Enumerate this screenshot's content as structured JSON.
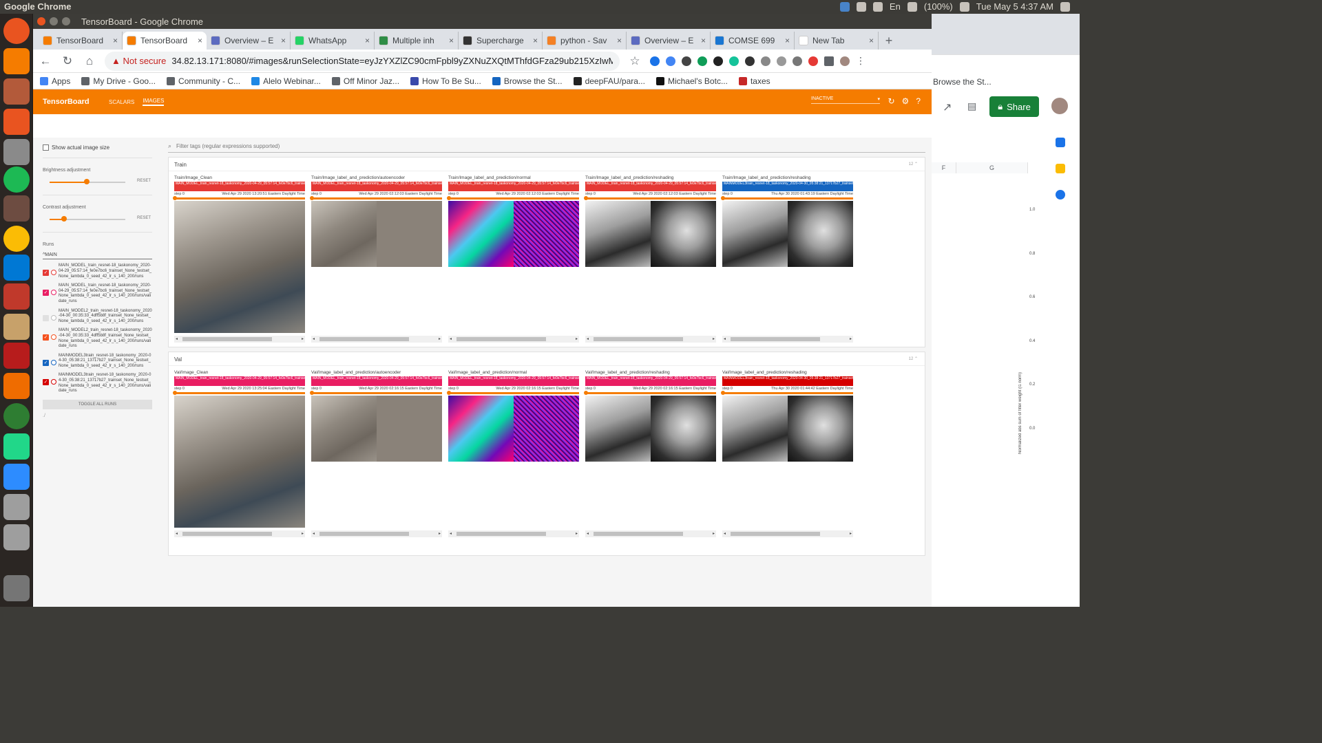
{
  "os": {
    "app_name": "Google Chrome",
    "tray": {
      "keyboard": "En",
      "battery": "(100%)",
      "clock": "Tue May 5  4:37 AM"
    }
  },
  "window": {
    "title": "TensorBoard - Google Chrome"
  },
  "tabs": [
    {
      "label": "TensorBoard",
      "color": "#f57c00"
    },
    {
      "label": "TensorBoard",
      "color": "#f57c00",
      "active": true
    },
    {
      "label": "Overview – E",
      "color": "#5c6bc0"
    },
    {
      "label": "WhatsApp",
      "color": "#25d366"
    },
    {
      "label": "Multiple inh",
      "color": "#2f8d46"
    },
    {
      "label": "Supercharge",
      "color": "#333333"
    },
    {
      "label": "python - Sav",
      "color": "#f48024"
    },
    {
      "label": "Overview – E",
      "color": "#5c6bc0"
    },
    {
      "label": "COMSE 699",
      "color": "#1976d2"
    },
    {
      "label": "New Tab",
      "color": "#ffffff"
    }
  ],
  "omnibox": {
    "security": "Not secure",
    "url": "34.82.13.171:8080/#images&runSelectionState=eyJzYXZlZC90cmFpbl9yZXNuZXQtMThfdGFza29ub215XzIwMjAtMDQtMj..."
  },
  "bookmarks": [
    "Apps",
    "My Drive - Goo...",
    "Community - C...",
    "Alelo Webinar...",
    "Off Minor Jaz...",
    "How To Be Su...",
    "Browse the St...",
    "deepFAU/para...",
    "Michael's Botc...",
    "taxes"
  ],
  "tensorboard": {
    "logo": "TensorBoard",
    "nav": [
      "SCALARS",
      "IMAGES"
    ],
    "inactive": "INACTIVE",
    "sidebar": {
      "show_actual": "Show actual image size",
      "brightness": "Brightness adjustment",
      "contrast": "Contrast adjustment",
      "reset": "RESET",
      "runs_label": "Runs",
      "runs_filter": "^MAIN",
      "runs": [
        {
          "name": "MAIN_MODEL_train_resnet-18_taskonomy_2020-04-29_05:57:14_fe0e7bc6_trainset_None_testset_None_lambda_0_seed_42_lr_s_140_200/runs",
          "checked": true,
          "color": "#e53935"
        },
        {
          "name": "MAIN_MODEL_train_resnet-18_taskonomy_2020-04-29_05:57:14_fe0e7bc6_trainset_None_testset_None_lambda_0_seed_42_lr_s_140_200/runs/validate_runs",
          "checked": true,
          "color": "#e91e63"
        },
        {
          "name": "MAIN_MODEL2_train_resnet-18_taskonomy_2020-04-30_00:35:33_4dff5b8f_trainset_None_testset_None_lambda_0_seed_42_lr_s_140_200/runs",
          "checked": false,
          "color": "#bdbdbd"
        },
        {
          "name": "MAIN_MODEL2_train_resnet-18_taskonomy_2020-04-30_00:35:33_4dff5b8f_trainset_None_testset_None_lambda_0_seed_42_lr_s_140_200/runs/validate_runs",
          "checked": true,
          "color": "#f4511e"
        },
        {
          "name": "MAINMODEL3train_resnet-18_taskonomy_2020-04-30_05:38:21_13717b27_trainset_None_testset_None_lambda_0_seed_42_lr_s_140_200/runs",
          "checked": true,
          "color": "#1565c0"
        },
        {
          "name": "MAINMODEL3train_resnet-18_taskonomy_2020-04-30_05:38:21_13717b27_trainset_None_testset_None_lambda_0_seed_42_lr_s_140_200/runs/validate_runs",
          "checked": true,
          "color": "#d50000"
        }
      ],
      "toggle": "TOGGLE ALL RUNS",
      "footer": "./"
    },
    "filter_placeholder": "Filter tags (regular expressions supported)",
    "groups": [
      {
        "name": "Train",
        "count": "12",
        "cards": [
          {
            "title": "Train/Image_Clean",
            "run": "MAIN_MODEL_train_resnet-18_taskonomy_2020-04-29_05:57:14_fe0e7bc6_trainset_None_testset_None_lambda_0_seed_4",
            "step": "step 0",
            "time": "Wed Apr 29 2020 13:20:51 Eastern Daylight Time",
            "color": "#e53935"
          },
          {
            "title": "Train/Image_label_and_prediction/autoencoder",
            "run": "MAIN_MODEL_train_resnet-18_taskonomy_2020-04-29_05:57:14_fe0e7bc6_trainset_None_testset_None_lambda_0_seed_4",
            "step": "step 0",
            "time": "Wed Apr 29 2020 02:12:03 Eastern Daylight Time",
            "color": "#e53935"
          },
          {
            "title": "Train/Image_label_and_prediction/normal",
            "run": "MAIN_MODEL_train_resnet-18_taskonomy_2020-04-29_05:57:14_fe0e7bc6_trainset_None_testset_None_lambda_0_seed_4",
            "step": "step 0",
            "time": "Wed Apr 29 2020 02:12:03 Eastern Daylight Time",
            "color": "#e53935"
          },
          {
            "title": "Train/Image_label_and_prediction/reshading",
            "run": "MAIN_MODEL_train_resnet-18_taskonomy_2020-04-29_05:57:14_fe0e7bc6_trainset_None_testset_None_lambda_0_seed_4",
            "step": "step 0",
            "time": "Wed Apr 29 2020 02:12:03 Eastern Daylight Time",
            "color": "#e53935"
          },
          {
            "title": "Train/Image_label_and_prediction/reshading",
            "run": "MAINMODEL3train_resnet-18_taskonomy_2020-04-30_05:38:21_13717b27_trainset_None_testset_None_lambda_0_seed_4",
            "step": "step 0",
            "time": "Thu Apr 30 2020 01:43:19 Eastern Daylight Time",
            "color": "#1565c0"
          }
        ]
      },
      {
        "name": "Val",
        "count": "12",
        "cards": [
          {
            "title": "Val/Image_Clean",
            "run": "MAIN_MODEL_train_resnet-18_taskonomy_2020-04-29_05:57:14_fe0e7bc6_trainset_None_testset_None_lambda_0_seed_4",
            "step": "step 0",
            "time": "Wed Apr 29 2020 13:25:04 Eastern Daylight Time",
            "color": "#e91e63"
          },
          {
            "title": "Val/Image_label_and_prediction/autoencoder",
            "run": "MAIN_MODEL_train_resnet-18_taskonomy_2020-04-29_05:57:14_fe0e7bc6_trainset_None_testset_None_lambda_0_seed_4",
            "step": "step 0",
            "time": "Wed Apr 29 2020 02:16:15 Eastern Daylight Time",
            "color": "#e91e63"
          },
          {
            "title": "Val/Image_label_and_prediction/normal",
            "run": "MAIN_MODEL_train_resnet-18_taskonomy_2020-04-29_05:57:14_fe0e7bc6_trainset_None_testset_None_lambda_0_seed_4",
            "step": "step 0",
            "time": "Wed Apr 29 2020 02:16:15 Eastern Daylight Time",
            "color": "#e91e63"
          },
          {
            "title": "Val/Image_label_and_prediction/reshading",
            "run": "MAIN_MODEL_train_resnet-18_taskonomy_2020-04-29_05:57:14_fe0e7bc6_trainset_None_testset_None_lambda_0_seed_4",
            "step": "step 0",
            "time": "Wed Apr 29 2020 02:16:15 Eastern Daylight Time",
            "color": "#e91e63"
          },
          {
            "title": "Val/Image_label_and_prediction/reshading",
            "run": "MAINMODEL3train_resnet-18_taskonomy_2020-04-30_05:38:21_13717b27_trainset_None_testset_None_lambda_0_seed_4",
            "step": "step 0",
            "time": "Thu Apr 30 2020 01:44:42 Eastern Daylight Time",
            "color": "#d50000"
          }
        ]
      }
    ]
  },
  "background_window": {
    "bookmark": "Browse the St...",
    "share": "Share",
    "columns": [
      "F",
      "G"
    ],
    "y_ticks": [
      "1.0",
      "0.8",
      "0.6",
      "0.4",
      "0.2",
      "0.0"
    ],
    "y_label": "Normalized abs sum of filter weight (l1 norm)"
  }
}
